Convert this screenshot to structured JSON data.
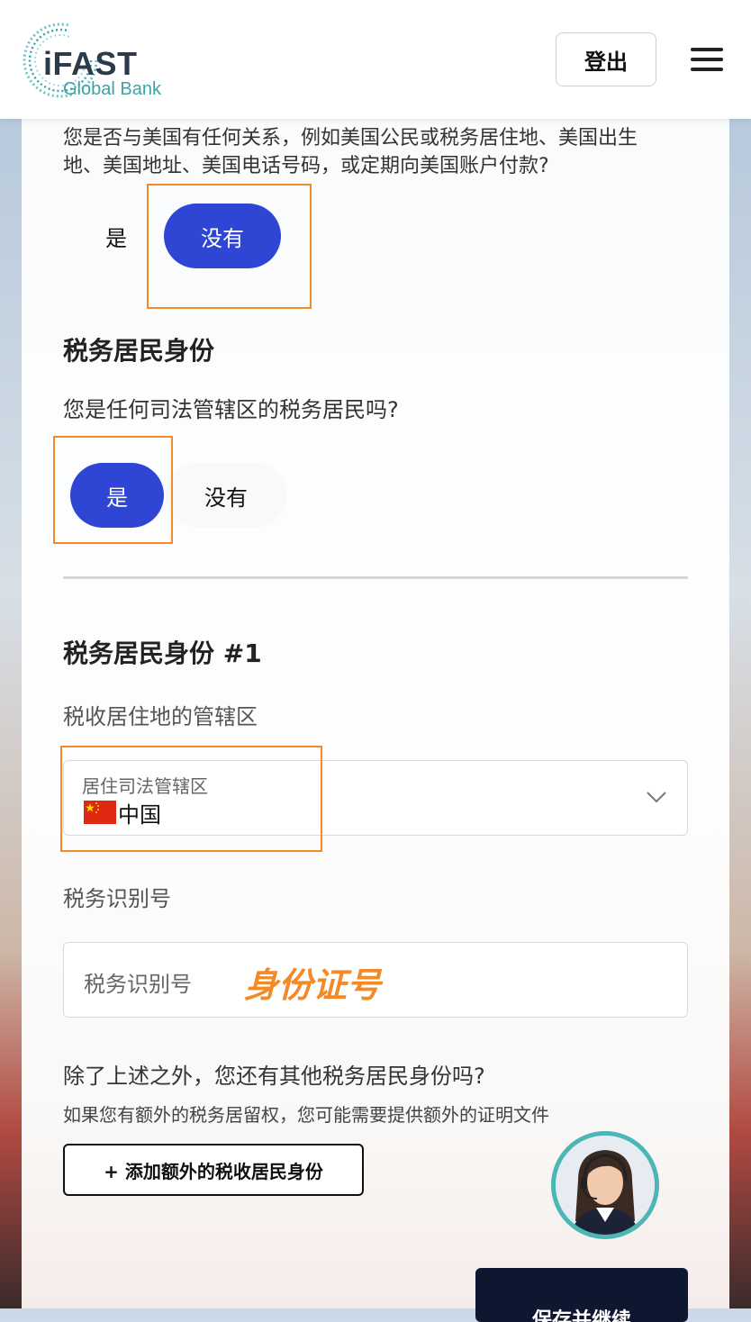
{
  "header": {
    "logo_main": "iFAST",
    "logo_sub": "Global Bank",
    "logout_label": "登出"
  },
  "us_relation": {
    "question_line1": "您是否与美国有任何关系，例如美国公民或税务居住地、美国出生",
    "question_line2": "地、美国地址、美国电话号码，或定期向美国账户付款?",
    "option_yes": "是",
    "option_no": "没有",
    "selected": "没有"
  },
  "tax_residency": {
    "title": "税务居民身份",
    "question": "您是任何司法管辖区的税务居民吗?",
    "option_yes": "是",
    "option_no": "没有",
    "selected": "是"
  },
  "tax_residency_1": {
    "title": "税务居民身份 #1",
    "jurisdiction_label": "税收居住地的管辖区",
    "select_label": "居住司法管辖区",
    "select_value": "中国",
    "tin_label": "税务识别号",
    "tin_placeholder": "税务识别号",
    "tin_annotation": "身份证号"
  },
  "additional": {
    "question": "除了上述之外，您还有其他税务居民身份吗?",
    "note": "如果您有额外的税务居留权，您可能需要提供额外的证明文件",
    "add_button": "+ 添加额外的税收居民身份"
  },
  "footer": {
    "save_button": "保存并继续"
  },
  "colors": {
    "accent_blue": "#2f45d3",
    "highlight_orange": "#f28a28",
    "logo_teal": "#3aa3a6",
    "save_dark": "#0f1630"
  },
  "icons": [
    "menu-icon",
    "chevron-down-icon",
    "china-flag-icon",
    "support-agent-avatar"
  ]
}
